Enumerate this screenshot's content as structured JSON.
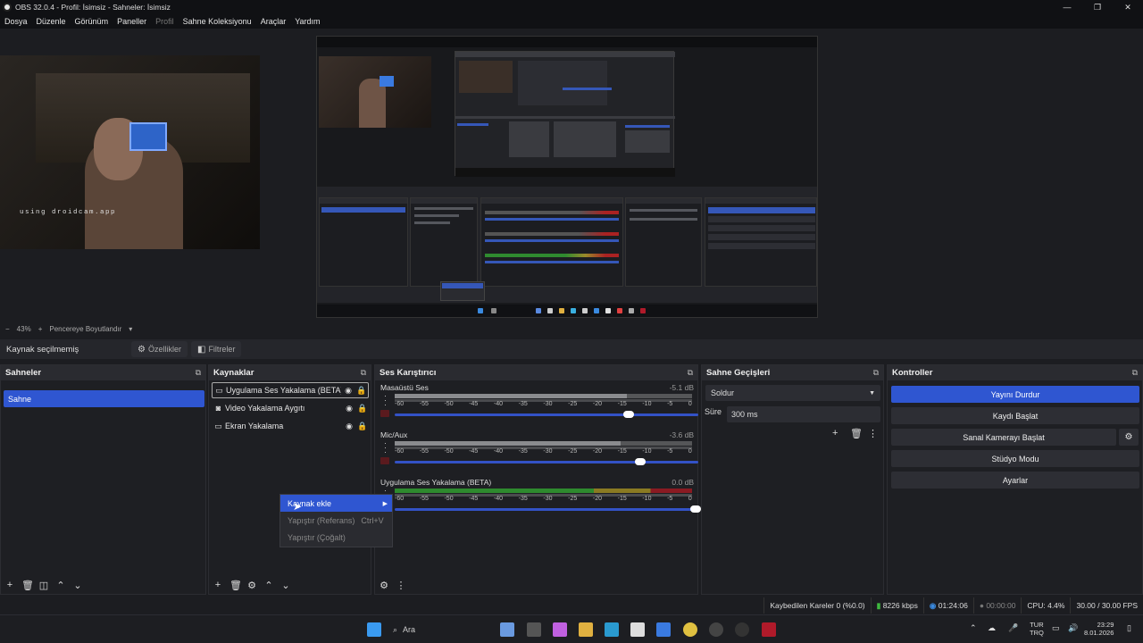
{
  "window": {
    "title": "OBS 32.0.4 - Profil: İsimsiz - Sahneler: İsimsiz",
    "minimize": "—",
    "maximize": "❐",
    "close": "✕"
  },
  "menu": [
    "Dosya",
    "Düzenle",
    "Görünüm",
    "Paneller",
    "Profil",
    "Sahne Koleksiyonu",
    "Araçlar",
    "Yardım"
  ],
  "preview": {
    "watermark": "using droidcam.app"
  },
  "zoom": {
    "minus": "−",
    "level": "43%",
    "plus": "+",
    "fit": "Pencereye Boyutlandır"
  },
  "source_toolbar": {
    "none_selected": "Kaynak seçilmemiş",
    "properties": "Özellikler",
    "filters": "Filtreler"
  },
  "scenes": {
    "title": "Sahneler",
    "items": [
      "Sahne"
    ]
  },
  "sources": {
    "title": "Kaynaklar",
    "items": [
      {
        "name": "Uygulama Ses Yakalama (BETA)",
        "icon": "monitor-icon"
      },
      {
        "name": "Video Yakalama Aygıtı",
        "icon": "camera-icon"
      },
      {
        "name": "Ekran Yakalama",
        "icon": "monitor-icon"
      }
    ]
  },
  "mixer": {
    "title": "Ses Karıştırıcı",
    "channels": [
      {
        "name": "Masaüstü Ses",
        "db": "-5.1 dB",
        "level": 0.78,
        "volume": 0.77
      },
      {
        "name": "Mic/Aux",
        "db": "-3.6 dB",
        "level": 0.76,
        "volume": 0.81
      },
      {
        "name": "Uygulama Ses Yakalama (BETA)",
        "db": "0.0 dB",
        "level": 1.0,
        "volume": 0.99
      }
    ],
    "ticks": [
      "-60",
      "-55",
      "-50",
      "-45",
      "-40",
      "-35",
      "-30",
      "-25",
      "-20",
      "-15",
      "-10",
      "-5",
      "0"
    ]
  },
  "transitions": {
    "title": "Sahne Geçişleri",
    "selected": "Soldur",
    "duration_label": "Süre",
    "duration": "300 ms"
  },
  "controls": {
    "title": "Kontroller",
    "buttons": [
      "Yayını Durdur",
      "Kaydı Başlat",
      "Sanal Kamerayı Başlat",
      "Stüdyo Modu",
      "Ayarlar"
    ]
  },
  "context_menu": {
    "items": [
      {
        "label": "Kaynak ekle",
        "shortcut": ""
      },
      {
        "label": "Yapıştır (Referans)",
        "shortcut": "Ctrl+V"
      },
      {
        "label": "Yapıştır (Çoğalt)",
        "shortcut": ""
      }
    ]
  },
  "status": {
    "dropped": "Kaybedilen Kareler 0 (%0.0)",
    "bitrate": "8226 kbps",
    "stream_time": "01:24:06",
    "rec_time": "00:00:00",
    "cpu": "CPU: 4.4%",
    "fps": "30.00 / 30.00 FPS"
  },
  "taskbar": {
    "search": "Ara",
    "lang1": "TUR",
    "lang2": "TRQ",
    "time": "23:29",
    "date": "8.01.2026"
  },
  "colors": {
    "accent": "#2f56d1",
    "background": "#1c1d21"
  }
}
